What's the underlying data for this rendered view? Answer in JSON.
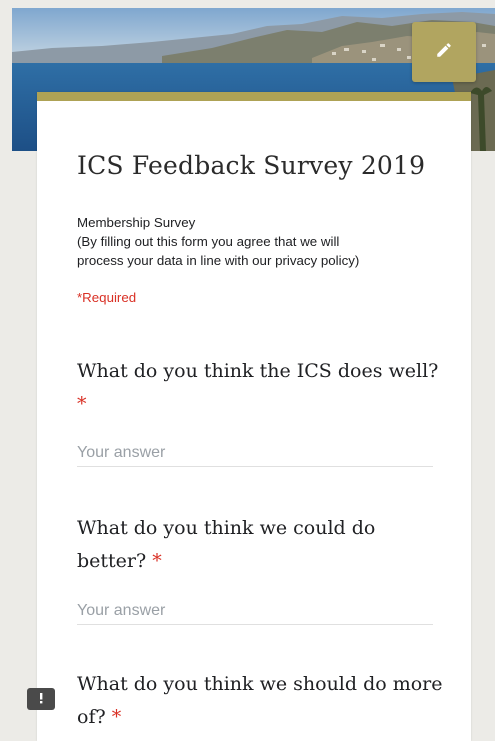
{
  "form": {
    "title": "ICS Feedback Survey 2019",
    "description_lines": [
      "Membership Survey",
      "(By filling out this form you agree that we will",
      "process your data in line with our privacy policy)"
    ],
    "required_note": "*Required",
    "questions": [
      {
        "text": "What do you think the ICS does well?",
        "required_mark": "*",
        "placeholder": "Your answer"
      },
      {
        "text_lines": [
          "What do you think we could do",
          "better?"
        ],
        "required_mark": "*",
        "placeholder": "Your answer"
      },
      {
        "text_lines": [
          "What do you think we should do more",
          "of?"
        ],
        "required_mark": "*"
      }
    ]
  },
  "icons": {
    "edit": "pencil-icon",
    "feedback": "report-icon"
  },
  "colors": {
    "theme": "#aea255",
    "fab": "#b1a560",
    "required": "#d93025"
  }
}
